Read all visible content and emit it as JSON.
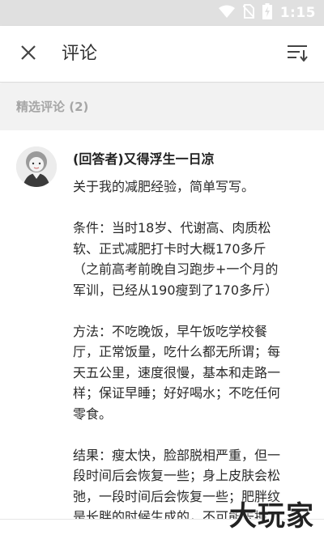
{
  "status_bar": {
    "time": "1:15",
    "icons": [
      "wifi-icon",
      "no-sim-icon",
      "battery-charging-icon"
    ]
  },
  "app_bar": {
    "title": "评论",
    "close_icon": "close-icon",
    "sort_icon": "sort-icon"
  },
  "section": {
    "label": "精选评论 (2)"
  },
  "comment": {
    "author": "(回答者)又得浮生一日凉",
    "paragraphs": [
      [
        "关于我的减肥经验，简单写写。"
      ],
      [
        "条件：当时18岁、代谢高、肉质松",
        "软、正式减肥打卡时大概170多斤",
        "（之前高考前晚自习跑步+一个月的",
        "军训，已经从190瘦到了170多斤）"
      ],
      [
        "方法：不吃晚饭，早午饭吃学校餐",
        "厅，正常饭量，吃什么都无所谓；每",
        "天五公里，速度很慢，基本和走路一",
        "样；保证早睡；好好喝水；不吃任何",
        "零食。"
      ],
      [
        "结果：瘦太快，脸部脱相严重，但一",
        "段时间后会恢复一些；身上皮肤会松",
        "弛，一段时间后会恢复一些；肥胖纹",
        "是长胖的时候生成的，不可能去掉"
      ]
    ]
  },
  "watermark": {
    "text": "大玩家"
  }
}
